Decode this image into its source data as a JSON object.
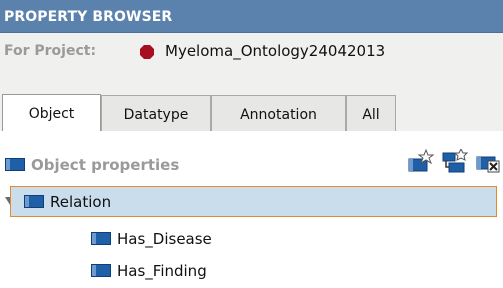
{
  "header": {
    "title": "PROPERTY BROWSER"
  },
  "project": {
    "label": "For Project:",
    "name": "Myeloma_Ontology24042013",
    "icon": "red-hexagon-icon"
  },
  "tabs": [
    {
      "label": "Object",
      "active": true
    },
    {
      "label": "Datatype",
      "active": false
    },
    {
      "label": "Annotation",
      "active": false
    },
    {
      "label": "All",
      "active": false
    }
  ],
  "section": {
    "title": "Object properties",
    "tools": [
      "create-property-icon",
      "create-subproperty-icon",
      "delete-property-icon"
    ]
  },
  "tree": [
    {
      "label": "Relation",
      "expanded": true,
      "selected": true,
      "children": [
        {
          "label": "Has_Disease"
        },
        {
          "label": "Has_Finding"
        }
      ]
    }
  ],
  "colors": {
    "header": "#5b82ad",
    "selection": "#c9dded",
    "selection_border": "#e58a2a",
    "property_icon": "#1f5fa7"
  }
}
